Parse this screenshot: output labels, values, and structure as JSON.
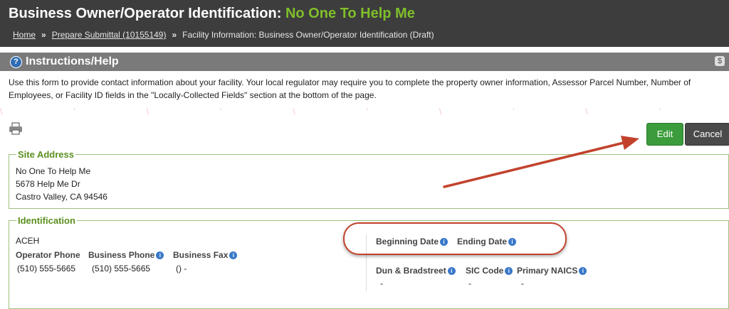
{
  "header": {
    "title": "Business Owner/Operator Identification:",
    "facility_name": "No One To Help Me",
    "breadcrumb": {
      "home": "Home",
      "sep": "»",
      "submittal": "Prepare Submittal (10155149)",
      "current": "Facility Information: Business Owner/Operator Identification (Draft)"
    }
  },
  "instructions": {
    "title": "Instructions/Help",
    "text": "Use this form to provide contact information about your facility. Your local regulator may require you to complete the property owner information, Assessor Parcel Number, Number of Employees, or Facility ID fields in the \"Locally-Collected Fields\" section at the bottom of the page."
  },
  "toolbar": {
    "edit_label": "Edit",
    "cancel_label": "Cancel",
    "print_icon": "printer-icon"
  },
  "site_address": {
    "legend": "Site Address",
    "name": "No One To Help Me",
    "street": "5678 Help Me Dr",
    "city_state_zip": "Castro Valley, CA  94546"
  },
  "identification": {
    "legend": "Identification",
    "operator": "ACEH",
    "operator_phone_label": "Operator Phone",
    "operator_phone": "(510) 555-5665",
    "business_phone_label": "Business Phone",
    "business_phone": "(510) 555-5665",
    "business_fax_label": "Business Fax",
    "business_fax": "() -",
    "beginning_date_label": "Beginning Date",
    "ending_date_label": "Ending Date",
    "dun_label": "Dun & Bradstreet",
    "sic_label": "SIC Code",
    "naics_label": "Primary NAICS",
    "dun_value": "-",
    "sic_value": "-",
    "naics_value": "-"
  },
  "colors": {
    "accent_green": "#7fbf2a",
    "edit_button": "#3b9c3b",
    "annotation_red": "#c2422c"
  }
}
